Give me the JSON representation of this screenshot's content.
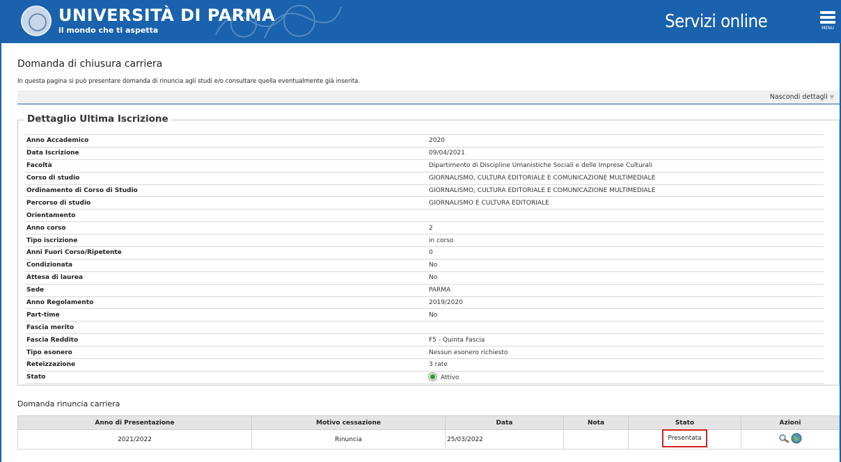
{
  "header": {
    "university": "UNIVERSITÀ DI PARMA",
    "tagline": "il mondo che ti aspetta",
    "service": "Servizi online",
    "menu_label": "MENU",
    "brand_color": "#1a62ad"
  },
  "page": {
    "title": "Domanda di chiusura carriera",
    "description": "In questa pagina si può presentare domanda di rinuncia agli studi e/o consultare quella eventualmente già inserita.",
    "toggle_details": "Nascondi dettagli"
  },
  "iscrizione": {
    "legend": "Dettaglio Ultima Iscrizione",
    "rows": [
      {
        "label": "Anno Accademico",
        "value": "2020"
      },
      {
        "label": "Data Iscrizione",
        "value": "09/04/2021"
      },
      {
        "label": "Facoltà",
        "value": "Dipartimento di Discipline Umanistiche Sociali e delle Imprese Culturali"
      },
      {
        "label": "Corso di studio",
        "value": "GIORNALISMO, CULTURA EDITORIALE E COMUNICAZIONE MULTIMEDIALE"
      },
      {
        "label": "Ordinamento di Corso di Studio",
        "value": "GIORNALISMO, CULTURA EDITORIALE E COMUNICAZIONE MULTIMEDIALE"
      },
      {
        "label": "Percorso di studio",
        "value": "GIORNALISMO E CULTURA EDITORIALE"
      },
      {
        "label": "Orientamento",
        "value": ""
      },
      {
        "label": "Anno corso",
        "value": "2"
      },
      {
        "label": "Tipo iscrizione",
        "value": "in corso"
      },
      {
        "label": "Anni Fuori Corso/Ripetente",
        "value": "0"
      },
      {
        "label": "Condizionata",
        "value": "No"
      },
      {
        "label": "Attesa di laurea",
        "value": "No"
      },
      {
        "label": "Sede",
        "value": "PARMA"
      },
      {
        "label": "Anno Regolamento",
        "value": "2019/2020"
      },
      {
        "label": "Part-time",
        "value": "No"
      },
      {
        "label": "Fascia merito",
        "value": ""
      },
      {
        "label": "Fascia Reddito",
        "value": "F5 - Quinta Fascia"
      },
      {
        "label": "Tipo esonero",
        "value": "Nessun esonero richiesto"
      },
      {
        "label": "Reteizzazione",
        "value": "3 rate"
      },
      {
        "label": "Stato",
        "value": "Attivo"
      }
    ]
  },
  "rinuncia": {
    "title": "Domanda rinuncia carriera",
    "headers": [
      "Anno di Presentazione",
      "Motivo cessazione",
      "Data",
      "Nota",
      "Stato",
      "Azioni"
    ],
    "row": {
      "anno": "2021/2022",
      "motivo": "Rinuncia",
      "data": "25/03/2022",
      "nota": "",
      "stato": "Presentata",
      "highlight_color": "#d42020"
    }
  }
}
